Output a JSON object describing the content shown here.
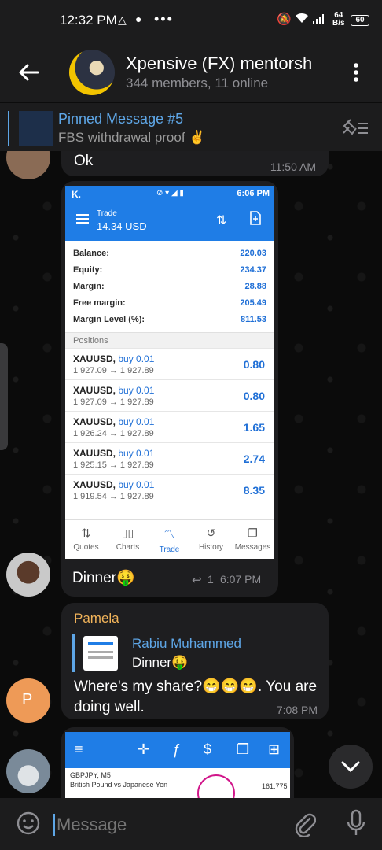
{
  "status": {
    "time": "12:32 PM",
    "net_speed_value": "64",
    "net_speed_unit": "B/s",
    "battery": "60"
  },
  "header": {
    "title": "Xpensive (FX) mentorsh",
    "subtitle": "344 members, 11 online"
  },
  "pinned": {
    "title": "Pinned Message #5",
    "text": "FBS withdrawal proof ✌️"
  },
  "messages": {
    "ok": {
      "text": "Ok",
      "time": "11:50 AM"
    },
    "dinner": {
      "text": "Dinner🤑",
      "replies": "1",
      "time": "6:07 PM"
    },
    "pamela": {
      "sender": "Pamela",
      "quote_author": "Rabiu Muhammed",
      "quote_text": "Dinner🤑",
      "text": "Where's my share?😁😁😁. You are doing well.",
      "time": "7:08 PM",
      "avatar_letter": "P"
    }
  },
  "trade_app": {
    "clock": "6:06 PM",
    "heading": "Trade",
    "balance_line": "14.34 USD",
    "account": [
      {
        "label": "Balance:",
        "value": "220.03"
      },
      {
        "label": "Equity:",
        "value": "234.37"
      },
      {
        "label": "Margin:",
        "value": "28.88"
      },
      {
        "label": "Free margin:",
        "value": "205.49"
      },
      {
        "label": "Margin Level (%):",
        "value": "811.53"
      }
    ],
    "positions_header": "Positions",
    "positions": [
      {
        "symbol": "XAUUSD,",
        "side": "buy 0.01",
        "prices": "1 927.09 → 1 927.89",
        "profit": "0.80"
      },
      {
        "symbol": "XAUUSD,",
        "side": "buy 0.01",
        "prices": "1 927.09 → 1 927.89",
        "profit": "0.80"
      },
      {
        "symbol": "XAUUSD,",
        "side": "buy 0.01",
        "prices": "1 926.24 → 1 927.89",
        "profit": "1.65"
      },
      {
        "symbol": "XAUUSD,",
        "side": "buy 0.01",
        "prices": "1 925.15 → 1 927.89",
        "profit": "2.74"
      },
      {
        "symbol": "XAUUSD,",
        "side": "buy 0.01",
        "prices": "1 919.54 → 1 927.89",
        "profit": "8.35"
      }
    ],
    "tabs": [
      "Quotes",
      "Charts",
      "Trade",
      "History",
      "Messages"
    ]
  },
  "chart_preview": {
    "pair": "GBPJPY, M5",
    "desc": "British Pound vs Japanese Yen",
    "price": "161.775"
  },
  "input": {
    "placeholder": "Message"
  },
  "colors": {
    "accent": "#5ea6e6",
    "sender_name": "#f2b45a",
    "app_blue": "#1f7de6"
  }
}
